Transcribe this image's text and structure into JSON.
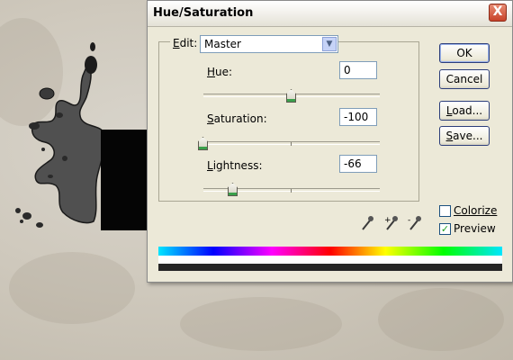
{
  "dialog": {
    "title": "Hue/Saturation",
    "close_label": "X"
  },
  "edit": {
    "label": "Edit:",
    "label_accel": "E",
    "label_rest": "dit:",
    "selected": "Master"
  },
  "hue": {
    "accel": "H",
    "rest": "ue:",
    "value": "0",
    "slider_fraction": 0.5
  },
  "saturation": {
    "accel": "S",
    "rest": "aturation:",
    "value": "-100",
    "slider_fraction": 0.0
  },
  "lightness": {
    "accel": "L",
    "rest": "ightness:",
    "value": "-66",
    "slider_fraction": 0.17
  },
  "buttons": {
    "ok": "OK",
    "cancel": "Cancel",
    "load_accel": "L",
    "load_rest": "oad...",
    "save_accel": "S",
    "save_rest": "ave..."
  },
  "colorize": {
    "label": "Colorize",
    "checked": false
  },
  "preview": {
    "label": "Preview",
    "checked": true
  },
  "icons": [
    "eyedropper-icon",
    "eyedropper-plus-icon",
    "eyedropper-minus-icon"
  ],
  "colors": {
    "accent_check": "#21a121",
    "result_bar": "#262626",
    "close_button": "#c8432a"
  }
}
